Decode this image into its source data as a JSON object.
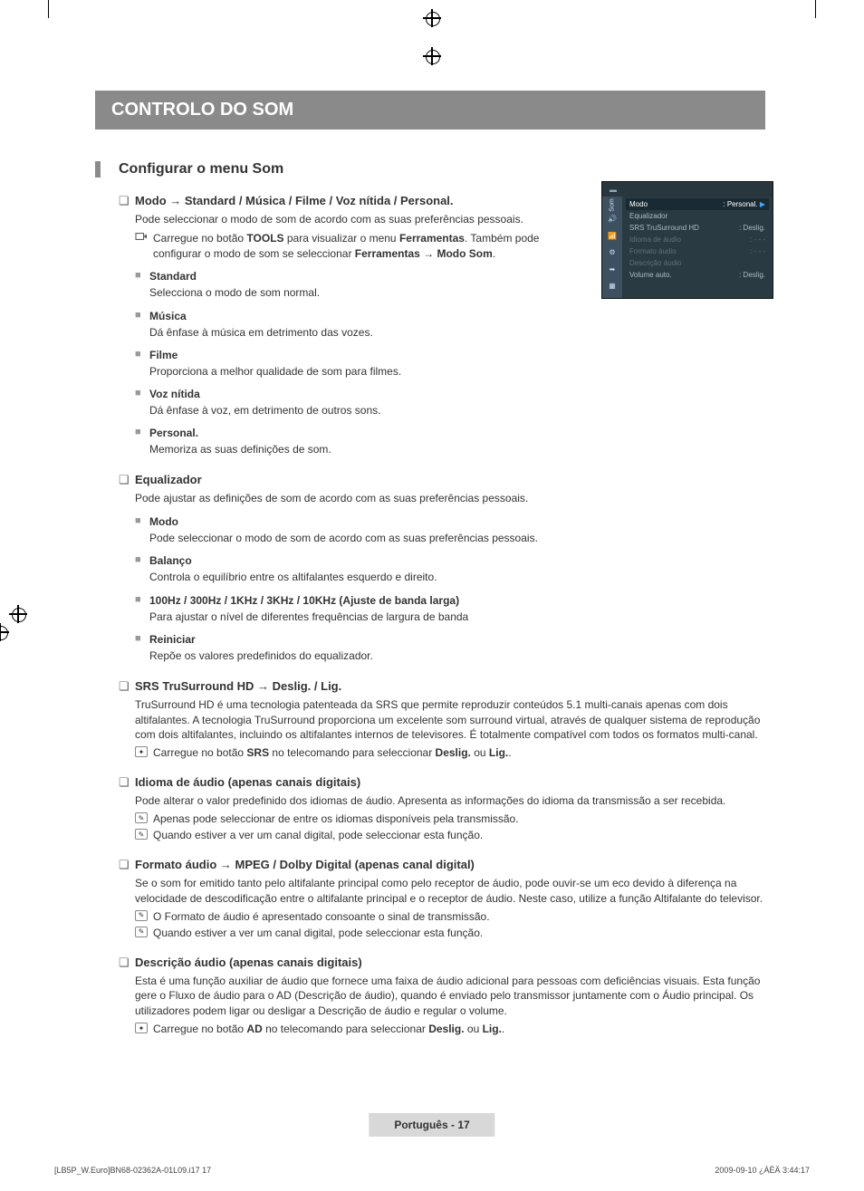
{
  "title_bar": "CONTROLO DO SOM",
  "section_heading": "Configurar o menu Som",
  "modo": {
    "title": "Modo → Standard / Música / Filme / Voz nítida / Personal.",
    "desc": "Pode seleccionar o modo de som de acordo com as suas preferências pessoais.",
    "tool_pre": "Carregue no botão ",
    "tool_bold1": "TOOLS",
    "tool_mid": " para visualizar o menu ",
    "tool_bold2": "Ferramentas",
    "tool_post": ". Também pode configurar o modo de som se seleccionar ",
    "tool_bold3": "Ferramentas → Modo Som",
    "tool_end": ".",
    "subs": [
      {
        "t": "Standard",
        "d": "Selecciona o modo de som normal."
      },
      {
        "t": "Música",
        "d": "Dá ênfase à música em detrimento das vozes."
      },
      {
        "t": "Filme",
        "d": "Proporciona a melhor qualidade de som para filmes."
      },
      {
        "t": "Voz nítida",
        "d": "Dá ênfase à voz, em detrimento de outros sons."
      },
      {
        "t": "Personal.",
        "d": "Memoriza as suas definições de som."
      }
    ]
  },
  "equalizador": {
    "title": "Equalizador",
    "desc": "Pode ajustar as definições de som de acordo com as suas preferências pessoais.",
    "subs": [
      {
        "t": "Modo",
        "d": "Pode seleccionar o modo de som de acordo com as suas preferências pessoais."
      },
      {
        "t": "Balanço",
        "d": "Controla o equilíbrio entre os altifalantes esquerdo e direito."
      },
      {
        "t": "100Hz / 300Hz / 1KHz / 3KHz / 10KHz (Ajuste de banda larga)",
        "d": "Para ajustar o nível de diferentes frequências de largura de banda"
      },
      {
        "t": "Reiniciar",
        "d": "Repõe os valores predefinidos do equalizador."
      }
    ]
  },
  "srs": {
    "title": "SRS TruSurround HD → Deslig. / Lig.",
    "desc": "TruSurround HD é uma tecnologia patenteada da SRS que permite reproduzir conteúdos 5.1 multi-canais apenas com dois altifalantes. A tecnologia TruSurround proporciona um excelente som surround virtual, através de qualquer sistema de reprodução com dois altifalantes, incluindo os altifalantes internos de televisores. É totalmente compatível com todos os formatos multi-canal.",
    "note_pre": "Carregue no botão ",
    "note_b1": "SRS",
    "note_mid": " no telecomando para seleccionar ",
    "note_b2": "Deslig.",
    "note_mid2": " ou ",
    "note_b3": "Lig.",
    "note_end": "."
  },
  "idioma": {
    "title": "Idioma de áudio (apenas canais digitais)",
    "desc": "Pode alterar o valor predefinido dos idiomas de áudio. Apresenta as informações do idioma da transmissão a ser recebida.",
    "notes": [
      "Apenas pode seleccionar de entre os idiomas disponíveis pela transmissão.",
      "Quando estiver a ver um canal digital, pode seleccionar esta função."
    ]
  },
  "formato": {
    "title": "Formato áudio → MPEG / Dolby Digital (apenas canal digital)",
    "desc": "Se o som for emitido tanto pelo altifalante principal como pelo receptor de áudio, pode ouvir-se um eco devido à diferença na velocidade de descodificação entre o altifalante principal e o receptor de áudio. Neste caso, utilize a função Altifalante do televisor.",
    "notes": [
      "O Formato de áudio é apresentado consoante o sinal de transmissão.",
      "Quando estiver a ver um canal digital, pode seleccionar esta função."
    ]
  },
  "descricao": {
    "title": "Descrição áudio (apenas canais digitais)",
    "desc": "Esta é uma função auxiliar de áudio que fornece uma faixa de áudio adicional para pessoas com deficiências visuais. Esta função gere o Fluxo de áudio para o AD (Descrição de áudio), quando é enviado pelo transmissor juntamente com o Áudio principal. Os utilizadores podem ligar ou desligar a Descrição de áudio e regular o volume.",
    "note_pre": "Carregue no botão ",
    "note_b1": "AD",
    "note_mid": " no telecomando para seleccionar ",
    "note_b2": "Deslig.",
    "note_mid2": " ou ",
    "note_b3": "Lig.",
    "note_end": "."
  },
  "osd": {
    "side_label": "Som",
    "rows": [
      {
        "l": "Modo",
        "r": ": Personal.",
        "sel": true
      },
      {
        "l": "Equalizador",
        "r": ""
      },
      {
        "l": "SRS TruSurround HD",
        "r": ": Deslig."
      },
      {
        "l": "Idioma de áudio",
        "r": ": - - -",
        "dim": true
      },
      {
        "l": "Formato áudio",
        "r": ": - - -",
        "dim": true
      },
      {
        "l": "Descrição áudio",
        "r": "",
        "dim": true
      },
      {
        "l": "Volume auto.",
        "r": ": Deslig."
      }
    ]
  },
  "footer": "Português - 17",
  "bottom_left": "[LB5P_W.Euro]BN68-02362A-01L09.i17   17",
  "bottom_right": "2009-09-10   ¿ÀÈÄ 3:44:17"
}
